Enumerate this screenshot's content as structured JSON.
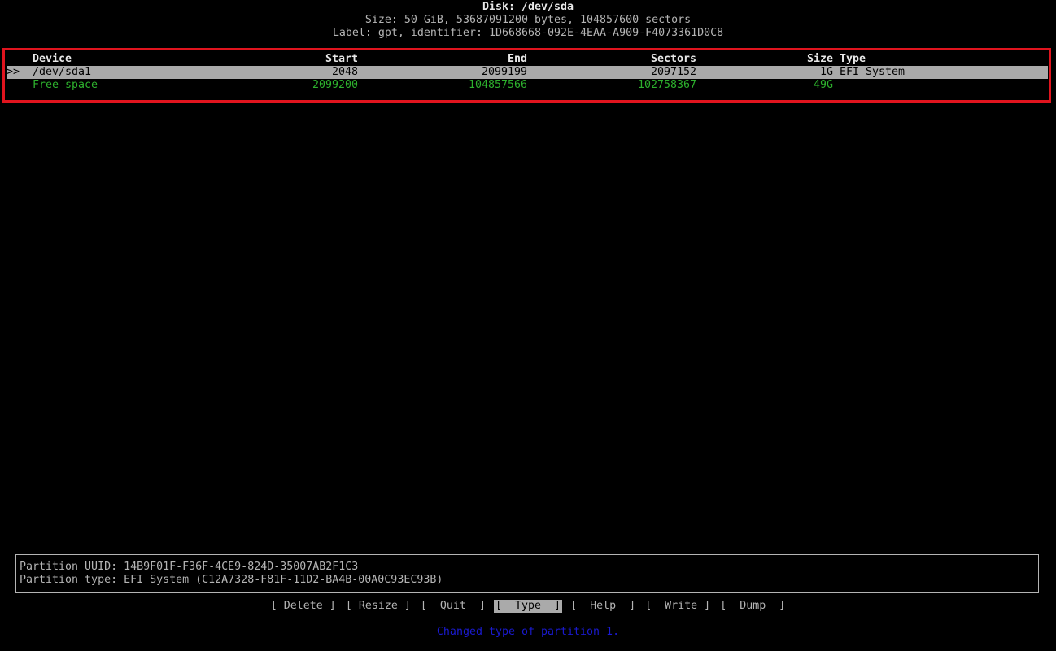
{
  "disk": {
    "title": "Disk: /dev/sda",
    "size_line": "Size: 50 GiB, 53687091200 bytes, 104857600 sectors",
    "label_line": "Label: gpt, identifier: 1D668668-092E-4EAA-A909-F4073361D0C8"
  },
  "table": {
    "headers": {
      "device": "Device",
      "start": "Start",
      "end": "End",
      "sectors": "Sectors",
      "size": "Size",
      "type": "Type"
    },
    "rows": [
      {
        "marker": ">>",
        "device": "/dev/sda1",
        "start": "2048",
        "end": "2099199",
        "sectors": "2097152",
        "size": "1G",
        "type": "EFI System"
      },
      {
        "marker": "",
        "device": "Free space",
        "start": "2099200",
        "end": "104857566",
        "sectors": "102758367",
        "size": "49G",
        "type": ""
      }
    ]
  },
  "info": {
    "uuid_line": "Partition UUID: 14B9F01F-F36F-4CE9-824D-35007AB2F1C3",
    "type_line": "Partition type: EFI System (C12A7328-F81F-11D2-BA4B-00A0C93EC93B)"
  },
  "menu": {
    "items": [
      "[ Delete ]",
      "[ Resize ]",
      "[  Quit  ]",
      "[  Type  ]",
      "[  Help  ]",
      "[  Write ]",
      "[  Dump  ]"
    ],
    "selected_index": 3
  },
  "status": "Changed type of partition 1.",
  "colors": {
    "background": "#000000",
    "text": "#b4b4b4",
    "selection": "#aaaaaa",
    "free_space": "#2db02d",
    "status": "#1a1ad0",
    "highlight_box": "#e0141e"
  }
}
